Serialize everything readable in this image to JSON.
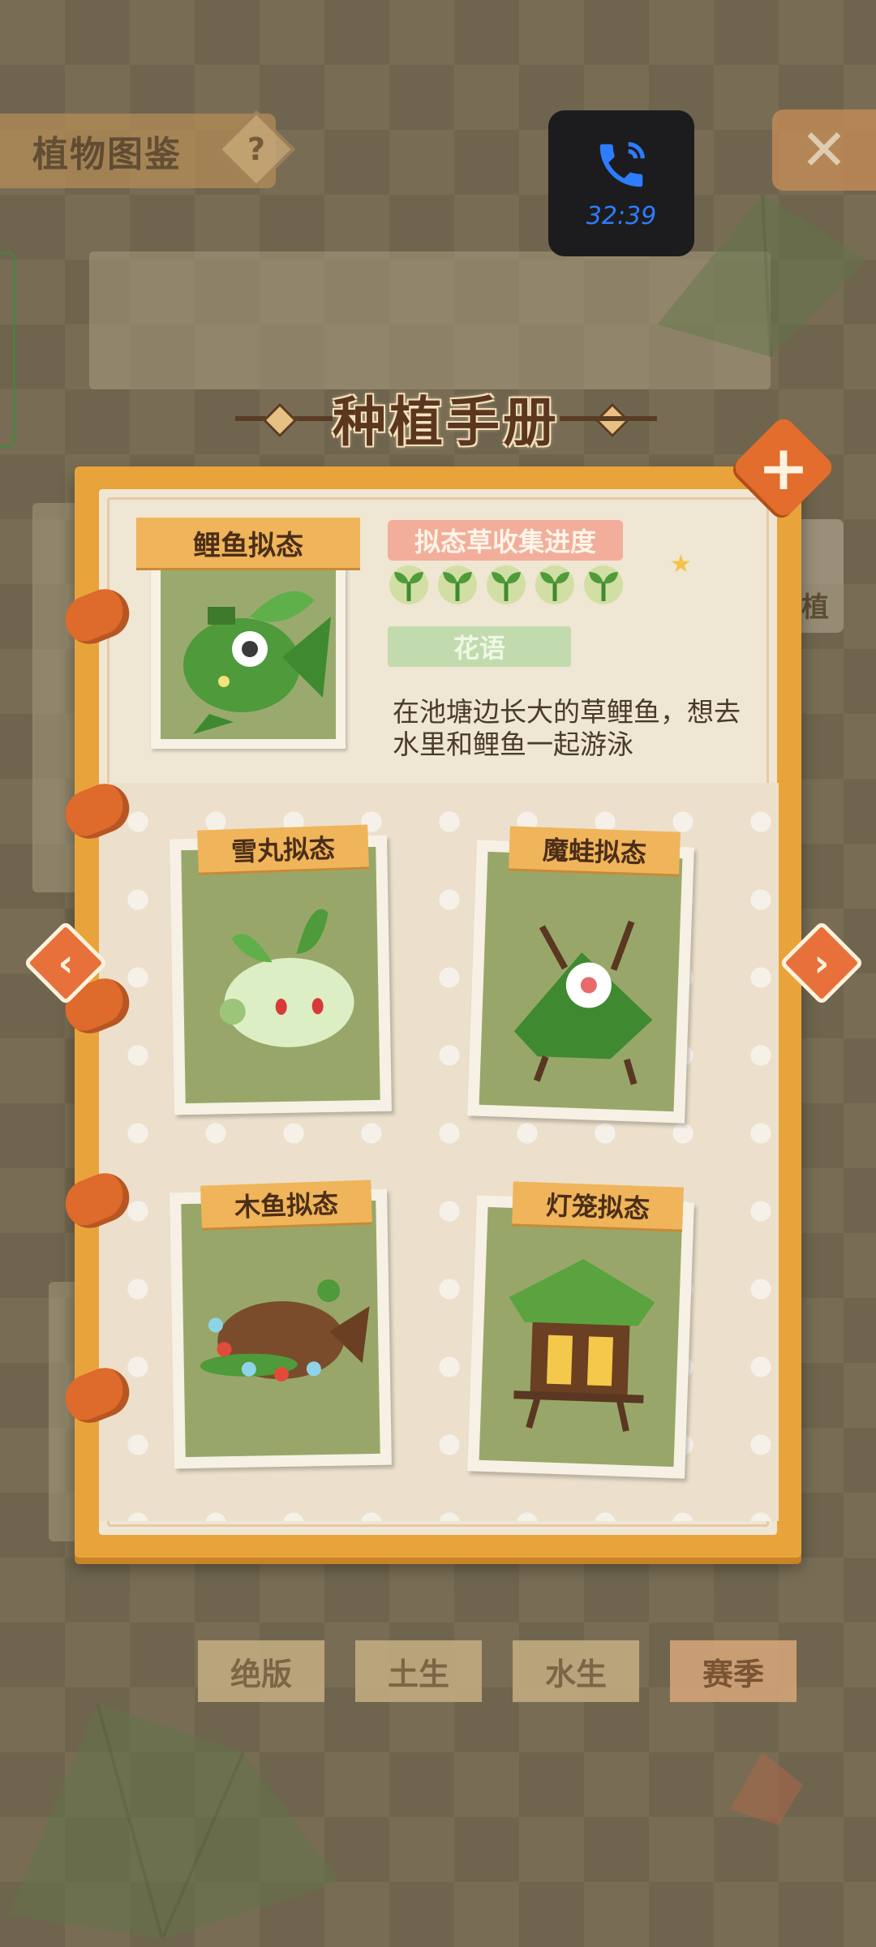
{
  "top": {
    "title": "植物图鉴",
    "help_glyph": "?",
    "close_glyph": "✕"
  },
  "call": {
    "time": "32:39"
  },
  "side_tab": {
    "label": "植"
  },
  "heading": {
    "title": "种植手册"
  },
  "featured": {
    "name": "鲤鱼拟态",
    "progress_label": "拟态草收集进度",
    "sprout_count": 5,
    "flower_label": "花语",
    "description": "在池塘边长大的草鲤鱼，想去水里和鲤鱼一起游泳"
  },
  "cards": [
    {
      "name": "雪丸拟态"
    },
    {
      "name": "魔蛙拟态"
    },
    {
      "name": "木鱼拟态"
    },
    {
      "name": "灯笼拟态"
    }
  ],
  "nav": {
    "prev_glyph": "‹",
    "next_glyph": "›",
    "plus_glyph": "+"
  },
  "tabs": [
    {
      "label": "绝版"
    },
    {
      "label": "土生"
    },
    {
      "label": "水生"
    },
    {
      "label": "赛季"
    }
  ],
  "colors": {
    "book": "#e9a33b",
    "label": "#f0b55a",
    "ring": "#de6a2b",
    "accent_green": "#5aa33f"
  }
}
